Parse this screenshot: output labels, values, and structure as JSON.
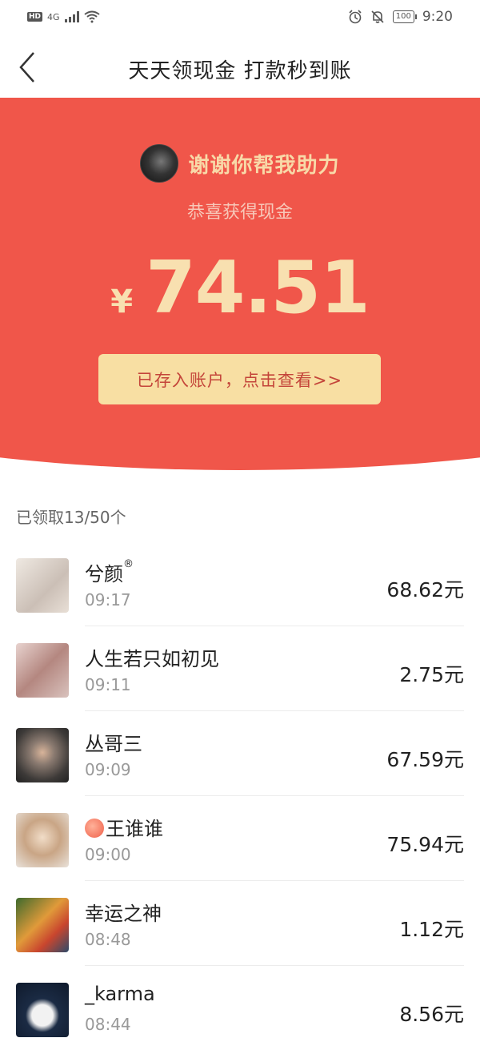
{
  "status_bar": {
    "network": "4G",
    "hd": "HD",
    "battery": "100",
    "time": "9:20"
  },
  "nav": {
    "title": "天天领现金 打款秒到账"
  },
  "hero": {
    "helper_text": "谢谢你帮我助力",
    "congrats": "恭喜获得现金",
    "currency": "¥",
    "amount": "74.51",
    "deposit_button": "已存入账户，点击查看>>"
  },
  "colors": {
    "hero_red": "#f0564a",
    "gold_text": "#f8e0b0",
    "button_bg": "#f8dfa3",
    "button_text": "#c4453a"
  },
  "claimed": {
    "label": "已领取13/50个"
  },
  "records": [
    {
      "name": "兮颜",
      "suffix": "®",
      "time": "09:17",
      "amount": "68.62元",
      "avatar_color": "#d9cfc6"
    },
    {
      "name": "人生若只如初见",
      "time": "09:11",
      "amount": "2.75元",
      "avatar_color": "#c9a7a3"
    },
    {
      "name": "丛哥三",
      "time": "09:09",
      "amount": "67.59元",
      "avatar_color": "#6f6a66"
    },
    {
      "name": "王谁谁",
      "prefix_icon": "peach-icon",
      "time": "09:00",
      "amount": "75.94元",
      "avatar_color": "#c9b39c"
    },
    {
      "name": "幸运之神",
      "time": "08:48",
      "amount": "1.12元",
      "avatar_color": "#5a7e3f"
    },
    {
      "name": "_karma",
      "time": "08:44",
      "amount": "8.56元",
      "avatar_color": "#233a5a"
    }
  ]
}
